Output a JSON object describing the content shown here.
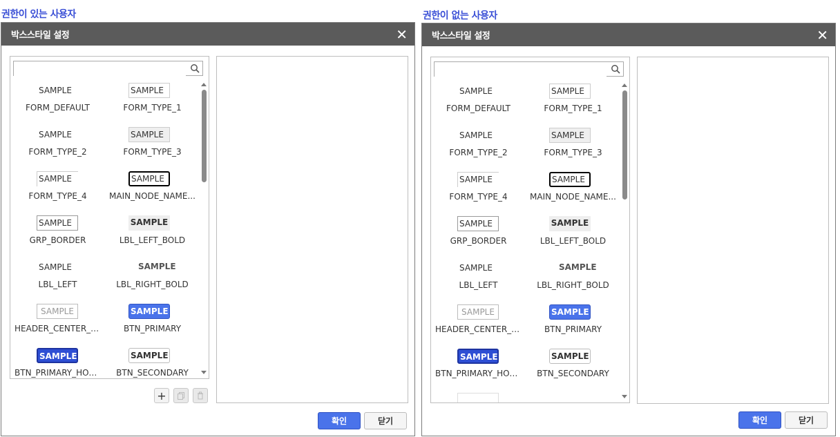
{
  "panels": [
    {
      "caption": "권한이 있는 사용자",
      "title": "박스스타일 설정",
      "search": {
        "value": "",
        "placeholder": ""
      },
      "items": [
        {
          "sample": "SAMPLE",
          "name": "FORM_DEFAULT"
        },
        {
          "sample": "SAMPLE",
          "name": "FORM_TYPE_1"
        },
        {
          "sample": "SAMPLE",
          "name": "FORM_TYPE_2"
        },
        {
          "sample": "SAMPLE",
          "name": "FORM_TYPE_3"
        },
        {
          "sample": "SAMPLE",
          "name": "FORM_TYPE_4"
        },
        {
          "sample": "SAMPLE",
          "name": "MAIN_NODE_NAME..."
        },
        {
          "sample": "SAMPLE",
          "name": "GRP_BORDER"
        },
        {
          "sample": "SAMPLE",
          "name": "LBL_LEFT_BOLD"
        },
        {
          "sample": "SAMPLE",
          "name": "LBL_LEFT"
        },
        {
          "sample": "SAMPLE",
          "name": "LBL_RIGHT_BOLD"
        },
        {
          "sample": "SAMPLE",
          "name": "HEADER_CENTER_B..."
        },
        {
          "sample": "SAMPLE",
          "name": "BTN_PRIMARY"
        },
        {
          "sample": "SAMPLE",
          "name": "BTN_PRIMARY_HOVER"
        },
        {
          "sample": "SAMPLE",
          "name": "BTN_SECONDARY"
        }
      ],
      "actions": {
        "add": "+",
        "copy": "copy",
        "delete": "delete"
      },
      "ok": "확인",
      "close": "닫기"
    },
    {
      "caption": "권한이 없는 사용자",
      "title": "박스스타일 설정",
      "search": {
        "value": "",
        "placeholder": ""
      },
      "items": [
        {
          "sample": "SAMPLE",
          "name": "FORM_DEFAULT"
        },
        {
          "sample": "SAMPLE",
          "name": "FORM_TYPE_1"
        },
        {
          "sample": "SAMPLE",
          "name": "FORM_TYPE_2"
        },
        {
          "sample": "SAMPLE",
          "name": "FORM_TYPE_3"
        },
        {
          "sample": "SAMPLE",
          "name": "FORM_TYPE_4"
        },
        {
          "sample": "SAMPLE",
          "name": "MAIN_NODE_NAME..."
        },
        {
          "sample": "SAMPLE",
          "name": "GRP_BORDER"
        },
        {
          "sample": "SAMPLE",
          "name": "LBL_LEFT_BOLD"
        },
        {
          "sample": "SAMPLE",
          "name": "LBL_LEFT"
        },
        {
          "sample": "SAMPLE",
          "name": "LBL_RIGHT_BOLD"
        },
        {
          "sample": "SAMPLE",
          "name": "HEADER_CENTER_B..."
        },
        {
          "sample": "SAMPLE",
          "name": "BTN_PRIMARY"
        },
        {
          "sample": "SAMPLE",
          "name": "BTN_PRIMARY_HOVER"
        },
        {
          "sample": "SAMPLE",
          "name": "BTN_SECONDARY"
        }
      ],
      "ok": "확인",
      "close": "닫기"
    }
  ],
  "colors": {
    "accent": "#4a73ea",
    "caption": "#3a4fd6",
    "header": "#5b5b5b"
  }
}
